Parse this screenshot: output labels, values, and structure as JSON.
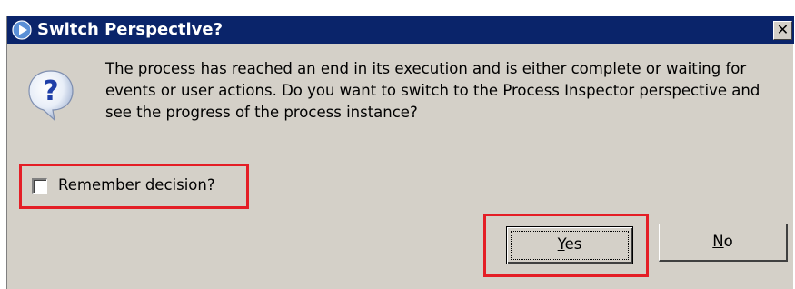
{
  "dialog": {
    "title": "Switch Perspective?",
    "close_glyph": "✕",
    "title_icon": "play-arrow-icon",
    "message_icon": "question-balloon-icon",
    "message": "The process has reached an end in its execution and is either complete or waiting for events or user actions. Do you want to switch to the Process Inspector perspective and see the progress of the process instance?",
    "remember_label": "Remember decision?",
    "remember_checked": false,
    "yes_label": "Yes",
    "no_label": "No"
  },
  "colors": {
    "titlebar": "#0a246a",
    "dialog_bg": "#d4d0c8",
    "highlight": "#e41e26"
  }
}
